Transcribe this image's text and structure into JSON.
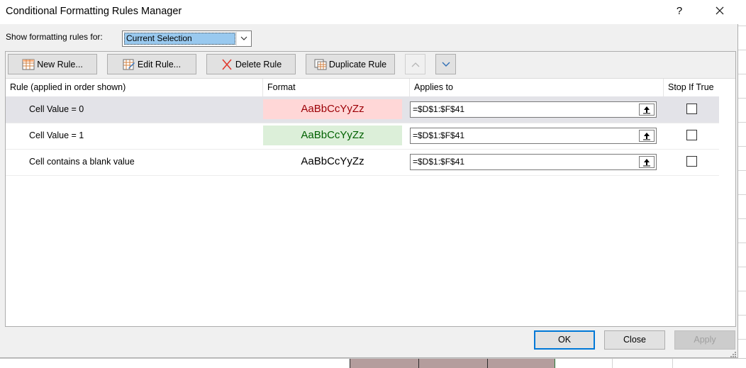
{
  "title": "Conditional Formatting Rules Manager",
  "help_glyph": "?",
  "show_rules": {
    "label": "Show formatting rules for:",
    "selected": "Current Selection"
  },
  "toolbar": {
    "new_rule": "New Rule...",
    "edit_rule": "Edit Rule...",
    "delete_rule": "Delete Rule",
    "duplicate_rule": "Duplicate Rule"
  },
  "columns": [
    "Rule (applied in order shown)",
    "Format",
    "Applies to",
    "Stop If True"
  ],
  "rules": [
    {
      "name": "Cell Value = 0",
      "format_preview": "AaBbCcYyZz",
      "format_bg": "#ffd7d7",
      "format_fg": "#9c0006",
      "applies_to": "=$D$1:$F$41",
      "stop_if_true": false,
      "selected": true
    },
    {
      "name": "Cell Value = 1",
      "format_preview": "AaBbCcYyZz",
      "format_bg": "#dcefd9",
      "format_fg": "#006100",
      "applies_to": "=$D$1:$F$41",
      "stop_if_true": false,
      "selected": false
    },
    {
      "name": "Cell contains a blank value",
      "format_preview": "AaBbCcYyZz",
      "format_bg": "#ffffff",
      "format_fg": "#000000",
      "applies_to": "=$D$1:$F$41",
      "stop_if_true": false,
      "selected": false
    }
  ],
  "buttons": {
    "ok": "OK",
    "close": "Close",
    "apply": "Apply"
  }
}
